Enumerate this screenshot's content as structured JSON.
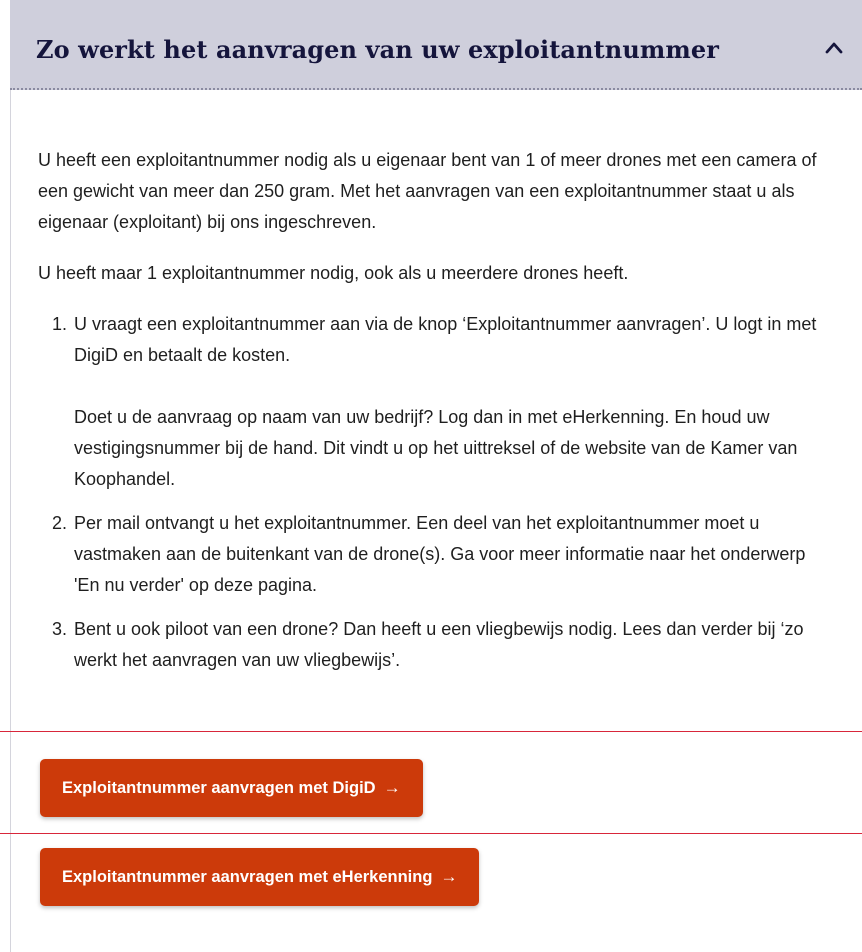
{
  "header": {
    "title": "Zo werkt het aanvragen van uw exploitantnummer",
    "toggle_icon": "chevron-up-icon"
  },
  "content": {
    "intro": "U heeft een exploitantnummer nodig als u eigenaar bent van 1 of meer drones met een camera of een gewicht van meer dan 250 gram. Met het aanvragen van een exploitantnummer staat u als eigenaar (exploitant) bij ons ingeschreven.",
    "note": "U heeft maar 1 exploitantnummer nodig, ook als u meerdere drones heeft.",
    "steps": [
      {
        "text": "U vraagt een exploitantnummer aan via de knop ‘Exploitantnummer aanvragen’. U logt in met DigiD en betaalt de kosten.",
        "extra": "Doet u de aanvraag op naam van uw bedrijf? Log dan in met eHerkenning. En houd uw vestigingsnummer bij de hand. Dit vindt u op het uittreksel of de website van de Kamer van Koophandel."
      },
      {
        "text": "Per mail ontvangt u het exploitantnummer. Een deel van het exploitantnummer moet u vastmaken aan de buitenkant van de drone(s). Ga voor meer informatie naar het onderwerp 'En nu verder' op deze pagina."
      },
      {
        "text": "Bent u ook piloot van een drone? Dan heeft u een vliegbewijs nodig. Lees dan verder bij ‘zo werkt het aanvragen van uw vliegbewijs’."
      }
    ]
  },
  "buttons": {
    "digid_label": "Exploitantnummer aanvragen met DigiD",
    "eherkenning_label": "Exploitantnummer aanvragen met eHerkenning",
    "arrow_icon": "arrow-right-icon"
  },
  "colors": {
    "header_bg": "#cfcfdc",
    "title": "#15153c",
    "button": "#cc3a0a",
    "red_line": "#d8263a"
  }
}
